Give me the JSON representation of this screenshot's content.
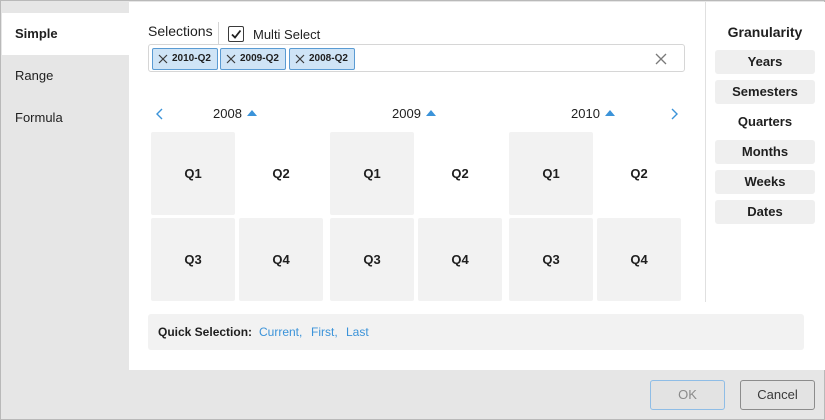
{
  "nav": {
    "items": [
      {
        "label": "Simple",
        "active": true
      },
      {
        "label": "Range",
        "active": false
      },
      {
        "label": "Formula",
        "active": false
      }
    ]
  },
  "selections": {
    "label": "Selections",
    "multi_select_label": "Multi Select",
    "multi_select_checked": true,
    "tokens": [
      "2010-Q2",
      "2009-Q2",
      "2008-Q2"
    ]
  },
  "calendar": {
    "years": [
      {
        "label": "2008",
        "quarters": [
          "Q1",
          "Q2",
          "Q3",
          "Q4"
        ],
        "selected": "Q2"
      },
      {
        "label": "2009",
        "quarters": [
          "Q1",
          "Q2",
          "Q3",
          "Q4"
        ],
        "selected": "Q2"
      },
      {
        "label": "2010",
        "quarters": [
          "Q1",
          "Q2",
          "Q3",
          "Q4"
        ],
        "selected": "Q2"
      }
    ]
  },
  "granularity": {
    "title": "Granularity",
    "options": [
      "Years",
      "Semesters",
      "Quarters",
      "Months",
      "Weeks",
      "Dates"
    ],
    "active": "Quarters"
  },
  "quick_selection": {
    "label": "Quick Selection:",
    "links": [
      "Current,",
      "First,",
      "Last"
    ]
  },
  "footer": {
    "ok_label": "OK",
    "cancel_label": "Cancel"
  },
  "colors": {
    "accent": "#3b93d9",
    "token_bg": "#cfe4f6",
    "token_border": "#5a9bd3"
  }
}
